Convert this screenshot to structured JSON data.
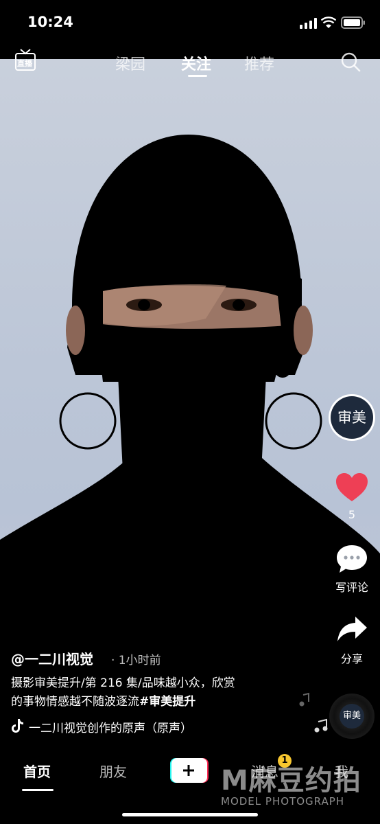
{
  "status": {
    "time": "10:24"
  },
  "topnav": {
    "live_label": "直播",
    "tabs": [
      {
        "label": "梁园"
      },
      {
        "label": "关注"
      },
      {
        "label": "推荐"
      }
    ]
  },
  "rail": {
    "avatar_text": "审美",
    "likes": "5",
    "comment_label": "写评论",
    "share_label": "分享",
    "disc_text": "审美"
  },
  "caption": {
    "author": "@一二川视觉",
    "time_ago": "· 1小时前",
    "line1": "摄影审美提升/第 216 集/品味越小众，欣赏",
    "line2_text": "的事物情感越不随波逐流",
    "line2_tag": "#审美提升",
    "music": "一二川视觉创作的原声（原声）"
  },
  "bottomnav": {
    "items": [
      {
        "label": "首页"
      },
      {
        "label": "朋友"
      },
      {
        "label": "消息",
        "badge": "1"
      },
      {
        "label": "我"
      }
    ]
  },
  "watermark": {
    "logo_text": "M麻豆约拍",
    "sub_text": "MODEL PHOTOGRAPH"
  },
  "colors": {
    "like": "#ee3f55",
    "badge": "#f7c62f"
  }
}
